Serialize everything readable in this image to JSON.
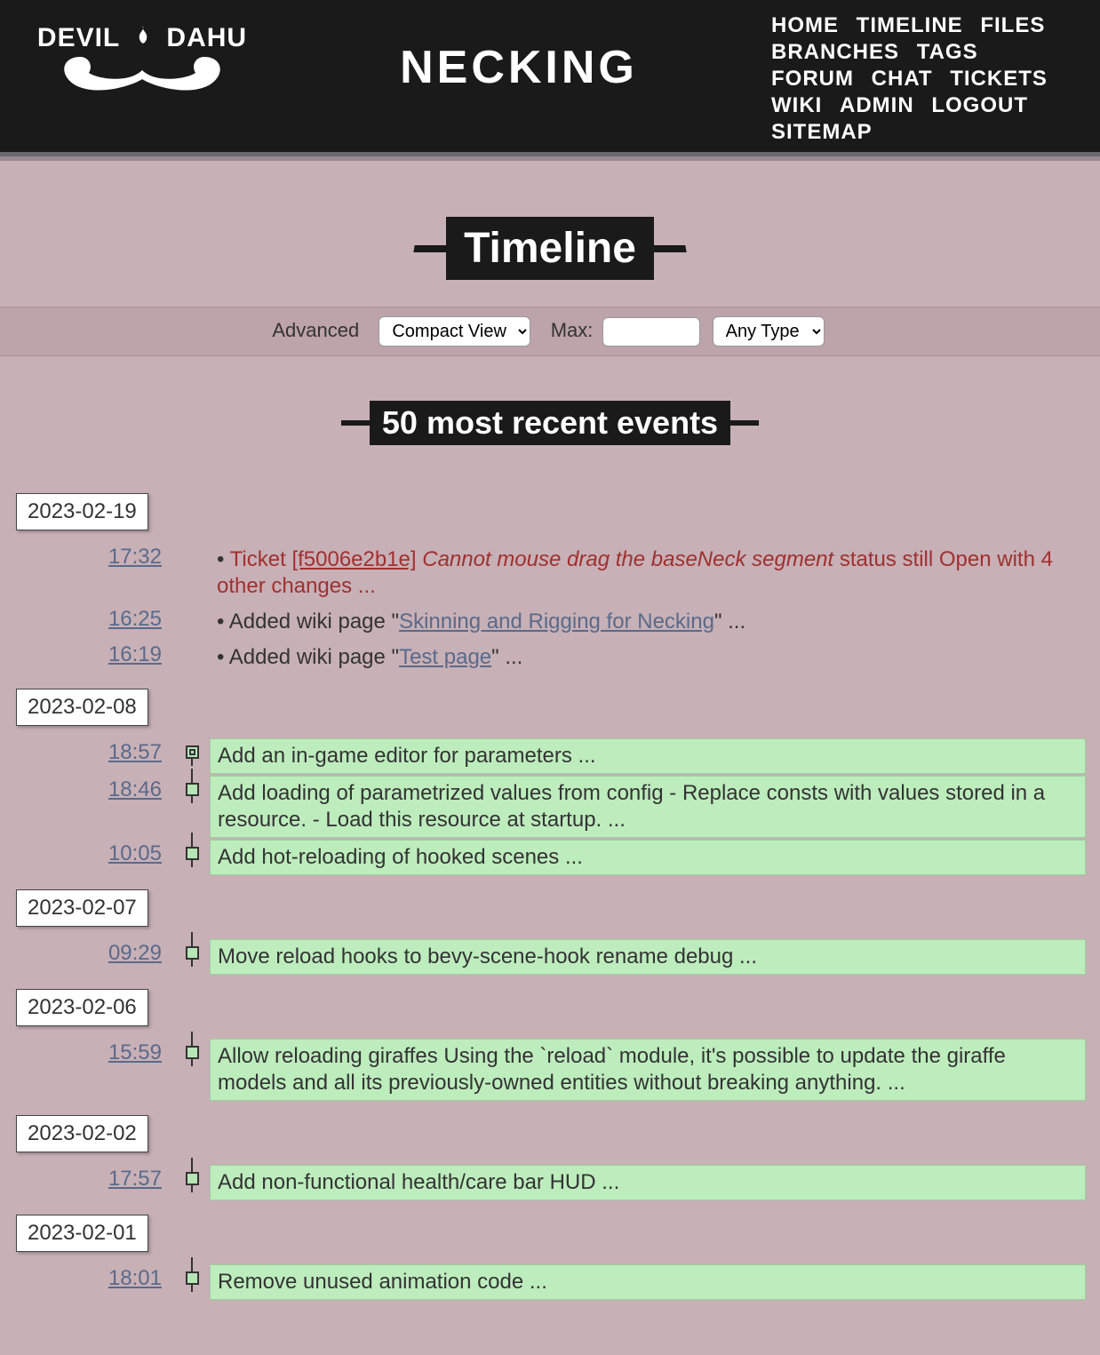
{
  "header": {
    "logo_line1": "DEVIL",
    "logo_line2": "DAHU",
    "project": "NECKING"
  },
  "nav": [
    "HOME",
    "TIMELINE",
    "FILES",
    "BRANCHES",
    "TAGS",
    "FORUM",
    "CHAT",
    "TICKETS",
    "WIKI",
    "ADMIN",
    "LOGOUT",
    "SITEMAP"
  ],
  "page_title": "Timeline",
  "controls": {
    "advanced": "Advanced",
    "view_options": [
      "Compact View"
    ],
    "view_selected": "Compact View",
    "max_label": "Max:",
    "max_value": "",
    "type_options": [
      "Any Type"
    ],
    "type_selected": "Any Type"
  },
  "subheader": "50 most recent events",
  "timeline": [
    {
      "type": "date",
      "date": "2023-02-19"
    },
    {
      "type": "ticket",
      "time": "17:32",
      "prefix": "Ticket ",
      "ticket_id": "[f5006e2b1e]",
      "title": "Cannot mouse drag the baseNeck segment",
      "suffix": " status still Open with 4 other changes ..."
    },
    {
      "type": "wiki",
      "time": "16:25",
      "prefix": "Added wiki page \"",
      "link": "Skinning and Rigging for Necking",
      "suffix": "\" ..."
    },
    {
      "type": "wiki",
      "time": "16:19",
      "prefix": "Added wiki page \"",
      "link": "Test page",
      "suffix": "\" ..."
    },
    {
      "type": "date",
      "date": "2023-02-08"
    },
    {
      "type": "checkin",
      "time": "18:57",
      "msg": "Add an in-game editor for parameters ...",
      "leaf": true
    },
    {
      "type": "checkin",
      "time": "18:46",
      "msg": "Add loading of parametrized values from config - Replace consts with values stored in a resource. - Load this resource at startup. ..."
    },
    {
      "type": "checkin",
      "time": "10:05",
      "msg": "Add hot-reloading of hooked scenes ..."
    },
    {
      "type": "date",
      "date": "2023-02-07"
    },
    {
      "type": "checkin",
      "time": "09:29",
      "msg": "Move reload hooks to bevy-scene-hook rename debug ..."
    },
    {
      "type": "date",
      "date": "2023-02-06"
    },
    {
      "type": "checkin",
      "time": "15:59",
      "msg": "Allow reloading giraffes Using the `reload` module, it's possible to update the giraffe models and all its previously-owned entities without breaking anything. ..."
    },
    {
      "type": "date",
      "date": "2023-02-02"
    },
    {
      "type": "checkin",
      "time": "17:57",
      "msg": "Add non-functional health/care bar HUD ..."
    },
    {
      "type": "date",
      "date": "2023-02-01"
    },
    {
      "type": "checkin",
      "time": "18:01",
      "msg": "Remove unused animation code ..."
    }
  ]
}
